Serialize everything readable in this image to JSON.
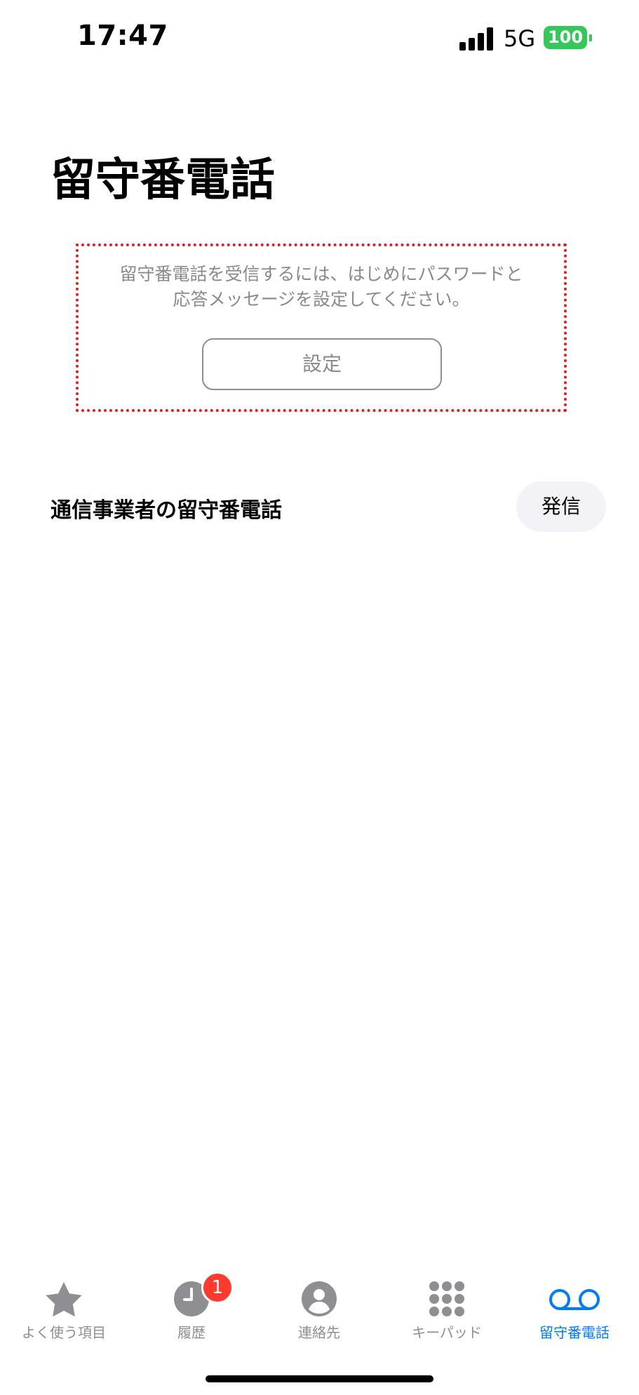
{
  "status_bar": {
    "time": "17:47",
    "network": "5G",
    "battery": "100",
    "battery_color": "#34c759"
  },
  "page": {
    "title": "留守番電話"
  },
  "setup": {
    "message_line1": "留守番電話を受信するには、はじめにパスワードと",
    "message_line2": "応答メッセージを設定してください。",
    "button_label": "設定",
    "highlight_color": "#e01e1e"
  },
  "carrier": {
    "label": "通信事業者の留守番電話",
    "call_label": "発信"
  },
  "tabs": [
    {
      "label": "よく使う項目",
      "icon": "star-icon",
      "active": false
    },
    {
      "label": "履歴",
      "icon": "clock-icon",
      "active": false,
      "badge": "1"
    },
    {
      "label": "連絡先",
      "icon": "person-icon",
      "active": false
    },
    {
      "label": "キーパッド",
      "icon": "keypad-icon",
      "active": false
    },
    {
      "label": "留守番電話",
      "icon": "voicemail-icon",
      "active": true
    }
  ],
  "colors": {
    "accent": "#007aff",
    "inactive": "#8e8e93",
    "badge": "#ff3b30"
  }
}
